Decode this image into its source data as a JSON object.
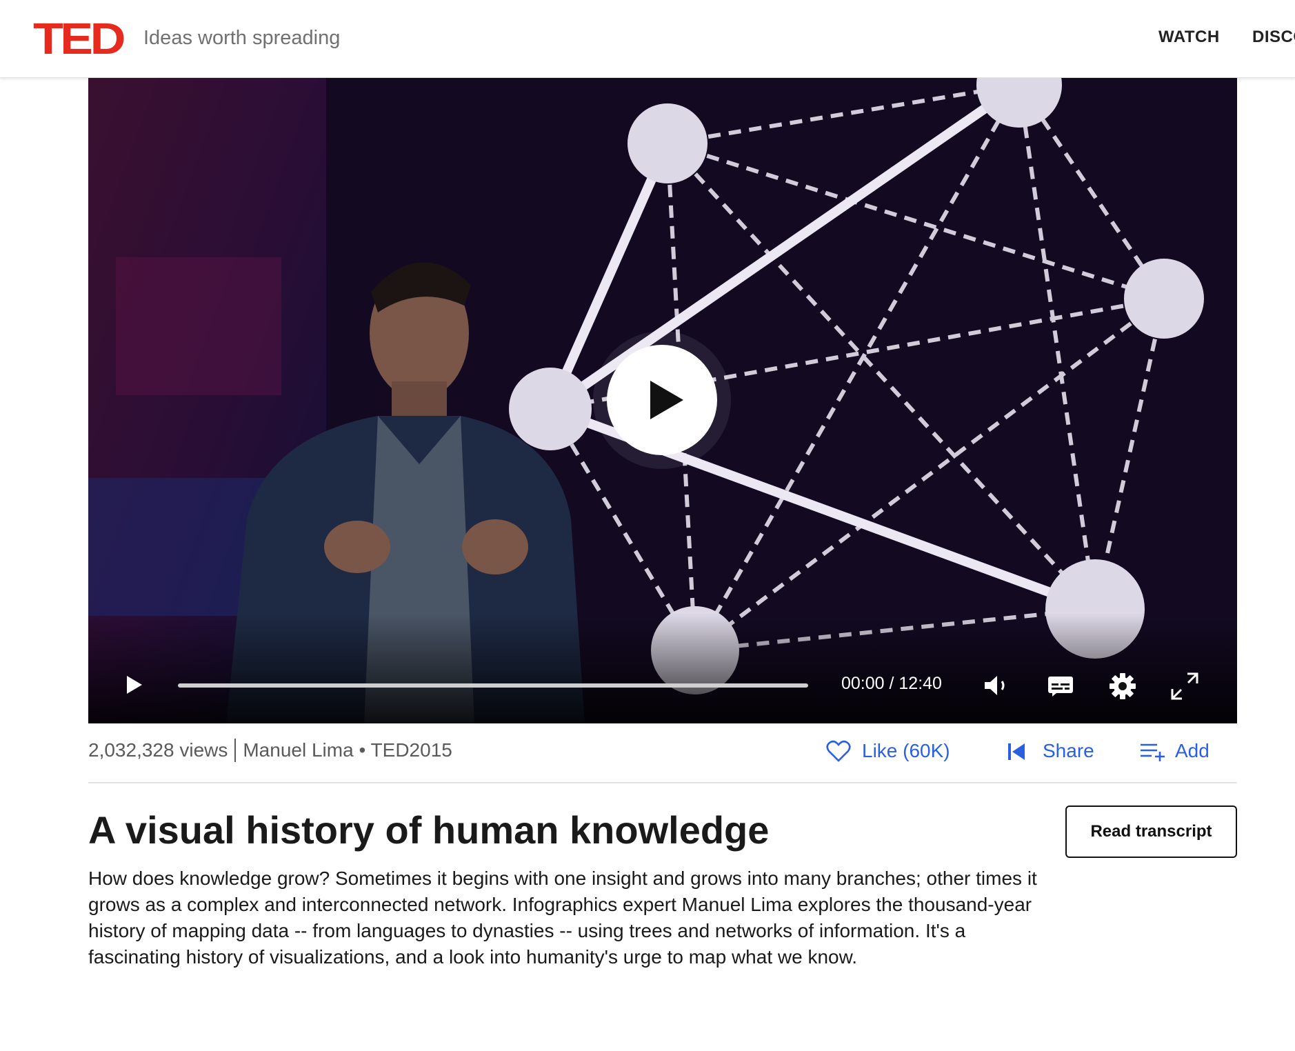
{
  "header": {
    "logo": "TED",
    "tagline": "Ideas worth spreading",
    "nav": [
      "WATCH",
      "DISCOVER"
    ]
  },
  "video": {
    "time_display": "00:00 / 12:40",
    "progress_fraction": 0,
    "icons": {
      "big_play": "play-icon",
      "play": "play-icon",
      "volume": "volume-icon",
      "captions": "captions-icon",
      "settings": "gear-icon",
      "fullscreen": "fullscreen-icon"
    }
  },
  "meta": {
    "views": "2,032,328 views",
    "speaker": "Manuel Lima",
    "bullet": "•",
    "event": "TED2015"
  },
  "actions": {
    "like": "Like (60K)",
    "share": "Share",
    "add": "Add"
  },
  "talk": {
    "title": "A visual history of human knowledge",
    "read_transcript": "Read transcript",
    "description": "How does knowledge grow? Sometimes it begins with one insight and grows into many branches; other times it grows as a complex and interconnected network. Infographics expert Manuel Lima explores the thousand-year history of mapping data -- from languages to dynasties -- using trees and networks of information. It's a fascinating history of visualizations, and a look into humanity's urge to map what we know."
  },
  "colors": {
    "brand_red": "#e62b1e",
    "link_blue": "#2a60e0",
    "video_bg": "#140a20"
  }
}
